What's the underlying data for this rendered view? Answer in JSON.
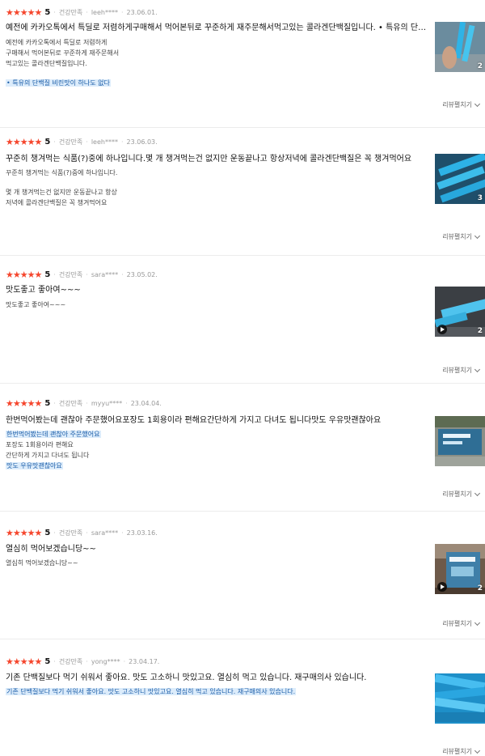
{
  "expand_label": "리뷰펼치기",
  "colors": {
    "star": "#f5462d",
    "highlight_bg": "#dcecfb",
    "highlight_text": "#1d5ea8"
  },
  "reviews": [
    {
      "score": "5",
      "badge": "건강만족",
      "user": "leeh****",
      "date": "23.06.01.",
      "summary": "예전에 카카오톡에서 특딜로 저렴하게구매해서 먹어본뒤로 꾸준하게 재주문해서먹고있는 콜라겐단백질입니다. • 특유의 단백질 비린맛이 하나도 없다",
      "lines": [
        "예전에 카카오톡에서 특딜로 저렴하게",
        "구매해서 먹어본뒤로 꾸준하게 재주문해서",
        "먹고있는 콜라겐단백질입니다.",
        "",
        "• 특유의 단백질 비린맛이 하나도 없다"
      ],
      "photo_count": "2",
      "has_video": false
    },
    {
      "score": "5",
      "badge": "건강만족",
      "user": "leeh****",
      "date": "23.06.03.",
      "summary": "꾸준히 챙겨먹는 식품(?)중에 하나입니다.몇 개 챙겨먹는건 없지만 운동끝나고 항상저녁에 콜라겐단백질은 꼭 챙겨먹어요",
      "lines": [
        "꾸준히 챙겨먹는 식품(?)중에 하나입니다.",
        "",
        "몇 개 챙겨먹는건 없지만 운동끝나고 항상",
        "저녁에 콜라겐단백질은 꼭 챙겨먹어요"
      ],
      "photo_count": "3",
      "has_video": false
    },
    {
      "score": "5",
      "badge": "건강만족",
      "user": "sara****",
      "date": "23.05.02.",
      "summary": "맛도좋고 좋아여~~~",
      "lines": [
        "맛도좋고 좋아여~~~"
      ],
      "photo_count": "2",
      "has_video": true
    },
    {
      "score": "5",
      "badge": "건강만족",
      "user": "myyu****",
      "date": "23.04.04.",
      "summary": "한번먹어봤는데 괜찮아 주문했어요포장도 1회용이라 편해요간단하게 가지고 다녀도 됩니다맛도 우유맛괜찮아요",
      "lines": [
        "한번먹어봤는데 괜찮아 주문했어요",
        "포장도 1회용이라 편해요",
        "간단하게 가지고 다녀도 됩니다",
        "맛도 우유맛괜찮아요"
      ],
      "photo_count": "",
      "has_video": false
    },
    {
      "score": "5",
      "badge": "건강만족",
      "user": "sara****",
      "date": "23.03.16.",
      "summary": "열심히 먹어보겠습니당~~",
      "lines": [
        "열심히 먹어보겠습니당~~"
      ],
      "photo_count": "2",
      "has_video": true
    },
    {
      "score": "5",
      "badge": "건강만족",
      "user": "yong****",
      "date": "23.04.17.",
      "summary": "기존 단백질보다 먹기 쉬워서 좋아요. 맛도 고소하니 맛있고요. 열심히 먹고 있습니다. 재구매의사 있습니다.",
      "lines": [
        "기존 단백질보다 먹기 쉬워서 좋아요. 맛도 고소하니 맛있고요. 열심히 먹고 있습니다. 재구매의사 있습니다."
      ],
      "photo_count": "",
      "has_video": false
    }
  ]
}
